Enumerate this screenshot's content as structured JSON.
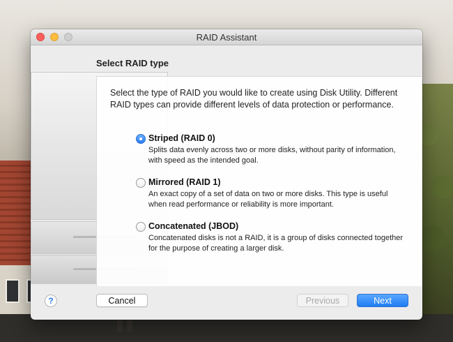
{
  "window": {
    "title": "RAID Assistant"
  },
  "page": {
    "heading": "Select RAID type",
    "description": "Select the type of RAID you would like to create using Disk Utility. Different RAID types can provide different levels of data protection or performance."
  },
  "options": [
    {
      "label": "Striped (RAID 0)",
      "description": "Splits data evenly across two or more disks, without parity of information, with speed as the intended goal.",
      "selected": true
    },
    {
      "label": "Mirrored (RAID 1)",
      "description": "An exact copy of a set of data on two or more disks. This type is useful when read performance or reliability is more important.",
      "selected": false
    },
    {
      "label": "Concatenated (JBOD)",
      "description": "Concatenated disks is not a RAID, it is a group of disks connected together for the purpose of creating a larger disk.",
      "selected": false
    }
  ],
  "buttons": {
    "help": "?",
    "cancel": "Cancel",
    "previous": "Previous",
    "next": "Next"
  },
  "colors": {
    "accent": "#2b7cf0",
    "close": "#fc605c",
    "minimize": "#fdbc40"
  }
}
